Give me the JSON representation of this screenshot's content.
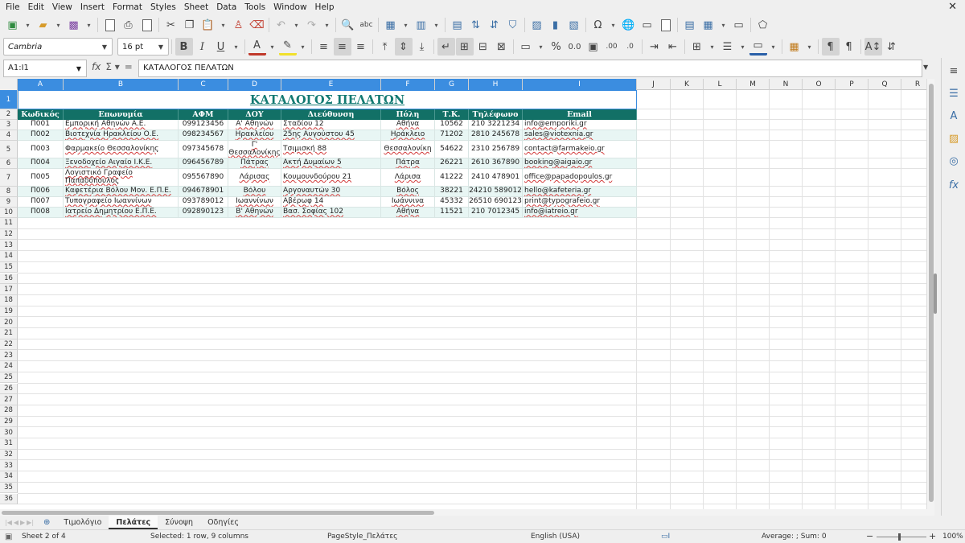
{
  "menu": [
    "File",
    "Edit",
    "View",
    "Insert",
    "Format",
    "Styles",
    "Sheet",
    "Data",
    "Tools",
    "Window",
    "Help"
  ],
  "formatting": {
    "font_name": "Cambria",
    "font_size": "16 pt"
  },
  "formula_bar": {
    "name_box": "A1:I1",
    "formula": "ΚΑΤΑΛΟΓΟΣ ΠΕΛΑΤΩΝ"
  },
  "columns": [
    "A",
    "B",
    "C",
    "D",
    "E",
    "F",
    "G",
    "H",
    "I",
    "J",
    "K",
    "L",
    "M",
    "N",
    "O",
    "P",
    "Q",
    "R"
  ],
  "rows": [
    "1",
    "2",
    "3",
    "4",
    "5",
    "6",
    "7",
    "8",
    "9",
    "10",
    "11",
    "12",
    "13",
    "14",
    "15",
    "16",
    "17",
    "18",
    "19",
    "20",
    "21",
    "22",
    "23",
    "24",
    "25",
    "26",
    "27",
    "28",
    "29",
    "30",
    "31",
    "32",
    "33",
    "34",
    "35",
    "36"
  ],
  "sheet": {
    "title": "ΚΑΤΑΛΟΓΟΣ ΠΕΛΑΤΩΝ",
    "headers": [
      "Κωδικός",
      "Επωνυμία",
      "ΑΦΜ",
      "ΔΟΥ",
      "Διεύθυνση",
      "Πόλη",
      "Τ.Κ.",
      "Τηλέφωνο",
      "Email"
    ],
    "records": [
      [
        "Π001",
        "Εμπορική Αθηνών Α.Ε.",
        "099123456",
        "Α' Αθηνών",
        "Σταδίου 12",
        "Αθήνα",
        "10562",
        "210 3221234",
        "info@emporiki.gr"
      ],
      [
        "Π002",
        "Βιοτεχνία Ηρακλείου Ο.Ε.",
        "098234567",
        "Ηρακλείου",
        "25ης Αυγούστου 45",
        "Ηράκλειο",
        "71202",
        "2810 245678",
        "sales@viotexnia.gr"
      ],
      [
        "Π003",
        "Φαρμακείο Θεσσαλονίκης",
        "097345678",
        "Γ' Θεσσαλονίκης",
        "Τσιμισκή 88",
        "Θεσσαλονίκη",
        "54622",
        "2310 256789",
        "contact@farmakeio.gr"
      ],
      [
        "Π004",
        "Ξενοδοχείο Αιγαίο Ι.Κ.Ε.",
        "096456789",
        "Πάτρας",
        "Ακτή Δυμαίων 5",
        "Πάτρα",
        "26221",
        "2610 367890",
        "booking@aigaio.gr"
      ],
      [
        "Π005",
        "Λογιστικό Γραφείο Παπαδόπουλος",
        "095567890",
        "Λάρισας",
        "Κουμουνδούρου 21",
        "Λάρισα",
        "41222",
        "2410 478901",
        "office@papadopoulos.gr"
      ],
      [
        "Π006",
        "Καφετέρια Βόλου Μον. Ε.Π.Ε.",
        "094678901",
        "Βόλου",
        "Αργοναυτών 30",
        "Βόλος",
        "38221",
        "24210 589012",
        "hello@kafeteria.gr"
      ],
      [
        "Π007",
        "Τυπογραφείο Ιωαννίνων",
        "093789012",
        "Ιωαννίνων",
        "Αβέρωφ 14",
        "Ιωάννινα",
        "45332",
        "26510 690123",
        "print@typografeio.gr"
      ],
      [
        "Π008",
        "Ιατρείο Δημητρίου Ε.Π.Ε.",
        "092890123",
        "Β' Αθηνών",
        "Βασ. Σοφίας 102",
        "Αθήνα",
        "11521",
        "210 7012345",
        "info@iatreio.gr"
      ]
    ]
  },
  "tabs": [
    "Τιμολόγιο",
    "Πελάτες",
    "Σύνοψη",
    "Οδηγίες"
  ],
  "active_tab": "Πελάτες",
  "status": {
    "sheet": "Sheet 2 of 4",
    "selection": "Selected: 1 row, 9 columns",
    "page_style": "PageStyle_Πελάτες",
    "language": "English (USA)",
    "sum": "Average: ; Sum: 0",
    "zoom": "100%"
  },
  "colors": {
    "accent": "#127066",
    "title": "#137a72",
    "selection": "#3b8de0",
    "alt_row": "#e8f6f4"
  }
}
